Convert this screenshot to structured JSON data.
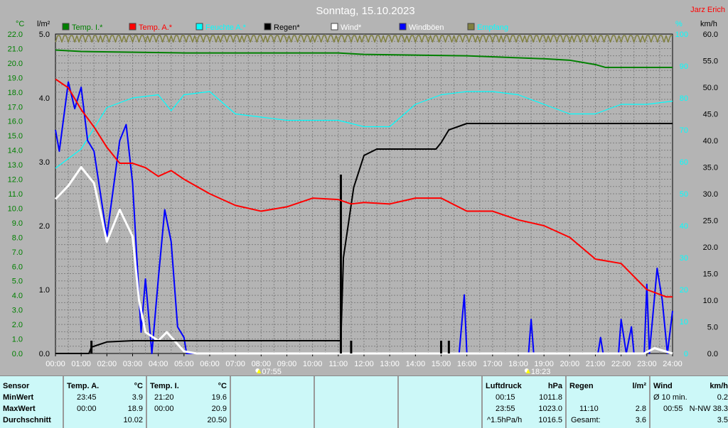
{
  "title": "Sonntag, 15.10.2023",
  "author": "Jarz Erich",
  "axis_units": {
    "left1": "°C",
    "left2": "l/m²",
    "right1": "%",
    "right2": "km/h"
  },
  "colors": {
    "temp_i": "#008000",
    "temp_a": "#ff0000",
    "humidity": "#00ffff",
    "rain": "#000000",
    "wind": "#ffffff",
    "gusts": "#0000ff",
    "reception": "#808040"
  },
  "chart_data": {
    "type": "line",
    "title": "Sonntag, 15.10.2023",
    "x_ticks": [
      "00:00",
      "01:00",
      "02:00",
      "03:00",
      "04:00",
      "05:00",
      "06:00",
      "07:00",
      "08:00",
      "09:00",
      "10:00",
      "11:00",
      "12:00",
      "13:00",
      "14:00",
      "15:00",
      "16:00",
      "17:00",
      "18:00",
      "19:00",
      "20:00",
      "21:00",
      "22:00",
      "23:00",
      "24:00"
    ],
    "xlim": [
      0,
      24
    ],
    "axes": {
      "temp_c": [
        0,
        22
      ],
      "rain_lm2": [
        0,
        5
      ],
      "percent": [
        0,
        100
      ],
      "kmh": [
        0,
        60
      ]
    },
    "sunrise": "07:55",
    "sunset": "18:23",
    "grid": true,
    "legend": [
      {
        "key": "temp_i",
        "label": "Temp. I.*",
        "axis": "temp_c"
      },
      {
        "key": "temp_a",
        "label": "Temp. A.*",
        "axis": "temp_c"
      },
      {
        "key": "humidity",
        "label": "Feuchte A.*",
        "axis": "percent"
      },
      {
        "key": "rain",
        "label": "Regen*",
        "axis": "rain_lm2"
      },
      {
        "key": "wind",
        "label": "Wind*",
        "axis": "kmh"
      },
      {
        "key": "gusts",
        "label": "Windböen",
        "axis": "kmh"
      },
      {
        "key": "reception",
        "label": "Empfang",
        "axis": "percent"
      }
    ],
    "series": {
      "temp_i": [
        [
          0,
          20.9
        ],
        [
          1,
          20.8
        ],
        [
          5,
          20.7
        ],
        [
          11,
          20.7
        ],
        [
          12,
          20.6
        ],
        [
          16,
          20.5
        ],
        [
          19,
          20.3
        ],
        [
          20,
          20.2
        ],
        [
          21,
          19.9
        ],
        [
          21.4,
          19.7
        ],
        [
          24,
          19.7
        ]
      ],
      "temp_a": [
        [
          0,
          18.9
        ],
        [
          0.5,
          18.3
        ],
        [
          1,
          16.8
        ],
        [
          1.5,
          15.6
        ],
        [
          2,
          14.2
        ],
        [
          2.5,
          13.1
        ],
        [
          3,
          13.1
        ],
        [
          3.5,
          12.8
        ],
        [
          4,
          12.2
        ],
        [
          4.5,
          12.6
        ],
        [
          5,
          12.0
        ],
        [
          6,
          11.0
        ],
        [
          7,
          10.2
        ],
        [
          8,
          9.8
        ],
        [
          9,
          10.1
        ],
        [
          10,
          10.7
        ],
        [
          11,
          10.6
        ],
        [
          11.5,
          10.3
        ],
        [
          12,
          10.4
        ],
        [
          13,
          10.3
        ],
        [
          14,
          10.7
        ],
        [
          15,
          10.7
        ],
        [
          16,
          9.8
        ],
        [
          17,
          9.8
        ],
        [
          18,
          9.2
        ],
        [
          19,
          8.8
        ],
        [
          20,
          8.0
        ],
        [
          21,
          6.5
        ],
        [
          22,
          6.2
        ],
        [
          23,
          4.4
        ],
        [
          23.75,
          3.9
        ],
        [
          24,
          3.9
        ]
      ],
      "humidity": [
        [
          0,
          58
        ],
        [
          1,
          64
        ],
        [
          2,
          77
        ],
        [
          3,
          80
        ],
        [
          4,
          81
        ],
        [
          4.5,
          76
        ],
        [
          5,
          81
        ],
        [
          6,
          82
        ],
        [
          7,
          75
        ],
        [
          8,
          74
        ],
        [
          9,
          73
        ],
        [
          10,
          73
        ],
        [
          11,
          73
        ],
        [
          12,
          71
        ],
        [
          13,
          71
        ],
        [
          14,
          78
        ],
        [
          15,
          81
        ],
        [
          16,
          82
        ],
        [
          17,
          82
        ],
        [
          18,
          81
        ],
        [
          19,
          78
        ],
        [
          20,
          75
        ],
        [
          21,
          75
        ],
        [
          22,
          78
        ],
        [
          23,
          78
        ],
        [
          24,
          79
        ]
      ],
      "rain": [
        [
          0,
          0
        ],
        [
          1.3,
          0
        ],
        [
          1.4,
          0.1
        ],
        [
          2,
          0.18
        ],
        [
          3,
          0.2
        ],
        [
          11.1,
          0.2
        ],
        [
          11.2,
          1.5
        ],
        [
          11.6,
          2.6
        ],
        [
          12,
          3.1
        ],
        [
          12.5,
          3.2
        ],
        [
          14.8,
          3.2
        ],
        [
          15,
          3.3
        ],
        [
          15.3,
          3.5
        ],
        [
          16,
          3.6
        ],
        [
          24,
          3.6
        ]
      ],
      "rain_rate_spikes": [
        [
          1.4,
          0.2
        ],
        [
          11.1,
          2.8
        ],
        [
          11.5,
          0.2
        ],
        [
          15,
          0.2
        ],
        [
          15.3,
          0.2
        ]
      ],
      "wind": [
        [
          0,
          29
        ],
        [
          0.5,
          31.5
        ],
        [
          1,
          35
        ],
        [
          1.5,
          32
        ],
        [
          2,
          21
        ],
        [
          2.5,
          27
        ],
        [
          3,
          22
        ],
        [
          3.25,
          10
        ],
        [
          3.5,
          4
        ],
        [
          4,
          2.4
        ],
        [
          4.33,
          4
        ],
        [
          5,
          0.4
        ],
        [
          5.5,
          0
        ],
        [
          22.9,
          0
        ],
        [
          23.3,
          1
        ],
        [
          24,
          0
        ]
      ],
      "gusts": [
        [
          0,
          42
        ],
        [
          0.15,
          38
        ],
        [
          0.5,
          51
        ],
        [
          0.75,
          46
        ],
        [
          1,
          50
        ],
        [
          1.25,
          40
        ],
        [
          1.5,
          38
        ],
        [
          2,
          22
        ],
        [
          2.5,
          40
        ],
        [
          2.75,
          43
        ],
        [
          3,
          32
        ],
        [
          3.33,
          4
        ],
        [
          3.5,
          14
        ],
        [
          3.75,
          0
        ],
        [
          4,
          14
        ],
        [
          4.25,
          27
        ],
        [
          4.5,
          21
        ],
        [
          4.75,
          5
        ],
        [
          5,
          3
        ],
        [
          5.1,
          0
        ],
        [
          15.7,
          0
        ],
        [
          15.9,
          11
        ],
        [
          16,
          0
        ],
        [
          18.4,
          0
        ],
        [
          18.5,
          6.4
        ],
        [
          18.6,
          0
        ],
        [
          21.1,
          0
        ],
        [
          21.2,
          3
        ],
        [
          21.3,
          0
        ],
        [
          21.9,
          0
        ],
        [
          22,
          6.4
        ],
        [
          22.2,
          0
        ],
        [
          22.4,
          5
        ],
        [
          22.5,
          0
        ],
        [
          22.9,
          0
        ],
        [
          23,
          13
        ],
        [
          23.1,
          0
        ],
        [
          23.4,
          16
        ],
        [
          23.6,
          10
        ],
        [
          23.8,
          0
        ],
        [
          24,
          8
        ]
      ],
      "reception": [
        [
          0,
          99
        ],
        [
          24,
          99
        ]
      ]
    }
  },
  "table": {
    "sensor": {
      "h": "Sensor",
      "min": "MinWert",
      "max": "MaxWert",
      "avg": "Durchschnitt"
    },
    "temp_a": {
      "h": "Temp. A.",
      "u": "°C",
      "min_t": "23:45",
      "min": "3.9",
      "max_t": "00:00",
      "max": "18.9",
      "avg": "10.02"
    },
    "temp_i": {
      "h": "Temp. I.",
      "u": "°C",
      "min_t": "21:20",
      "min": "19.6",
      "max_t": "00:00",
      "max": "20.9",
      "avg": "20.50"
    },
    "press": {
      "h": "Luftdruck",
      "u": "hPa",
      "min_t": "00:15",
      "min": "1011.8",
      "max_t": "23:55",
      "max": "1023.0",
      "avg_t": "^1.5hPa/h",
      "avg": "1016.5"
    },
    "rain": {
      "h": "Regen",
      "u": "l/m²",
      "max_t": "11:10",
      "max": "2.8",
      "tot_l": "Gesamt:",
      "tot": "3.6"
    },
    "wind": {
      "h": "Wind",
      "u": "km/h",
      "avg_l": "Ø 10 min.",
      "avg": "0.2",
      "max_t": "00:55",
      "max": "N-NW 38.3",
      "day": "3.5"
    }
  }
}
